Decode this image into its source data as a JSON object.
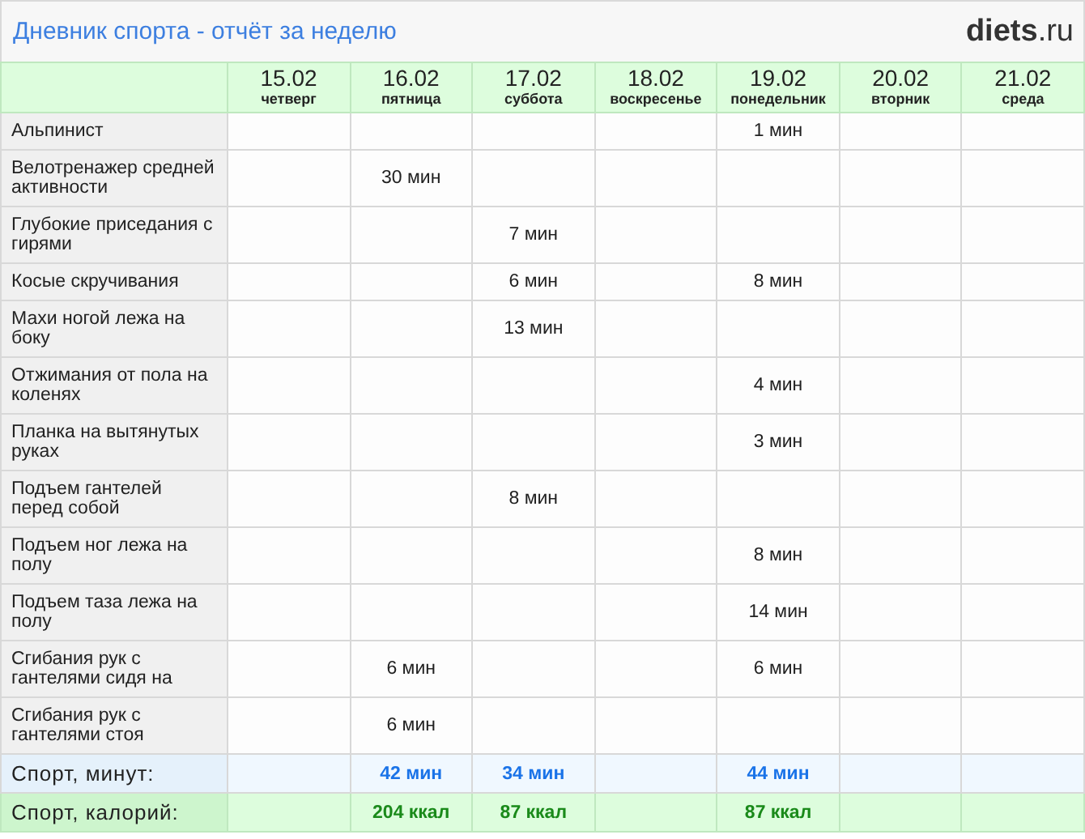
{
  "title": "Дневник спорта - отчёт за неделю",
  "logo": {
    "main": "diets",
    "suffix": ".ru"
  },
  "days": [
    {
      "date": "15.02",
      "weekday": "четверг"
    },
    {
      "date": "16.02",
      "weekday": "пятница"
    },
    {
      "date": "17.02",
      "weekday": "суббота"
    },
    {
      "date": "18.02",
      "weekday": "воскресенье"
    },
    {
      "date": "19.02",
      "weekday": "понедельник"
    },
    {
      "date": "20.02",
      "weekday": "вторник"
    },
    {
      "date": "21.02",
      "weekday": "среда"
    }
  ],
  "rows": [
    {
      "kind": "exercise",
      "name": "Альпинист",
      "cells": [
        {},
        {},
        {},
        {},
        {
          "text": "1 мин"
        },
        {},
        {}
      ]
    },
    {
      "kind": "exercise",
      "name": "Велотренажер средней активности",
      "cells": [
        {},
        {
          "text": "30 мин"
        },
        {},
        {},
        {},
        {},
        {}
      ]
    },
    {
      "kind": "exercise",
      "name": "Глубокие приседания с гирями",
      "cells": [
        {},
        {},
        {
          "text": "7 мин"
        },
        {},
        {},
        {},
        {}
      ]
    },
    {
      "kind": "exercise",
      "name": "Косые скручивания",
      "cells": [
        {},
        {},
        {
          "text": "6 мин"
        },
        {},
        {
          "text": "8 мин"
        },
        {},
        {}
      ]
    },
    {
      "kind": "exercise",
      "name": "Махи ногой лежа на боку",
      "cells": [
        {},
        {},
        {
          "text": "13 мин"
        },
        {},
        {},
        {},
        {}
      ]
    },
    {
      "kind": "exercise",
      "name": "Отжимания от пола на коленях",
      "cells": [
        {},
        {},
        {},
        {},
        {
          "text": "4 мин"
        },
        {},
        {}
      ]
    },
    {
      "kind": "exercise",
      "name": "Планка на вытянутых руках",
      "cells": [
        {},
        {},
        {},
        {},
        {
          "text": "3 мин"
        },
        {},
        {}
      ]
    },
    {
      "kind": "exercise",
      "name": "Подъем гантелей перед собой",
      "cells": [
        {},
        {},
        {
          "text": "8 мин"
        },
        {},
        {},
        {},
        {}
      ]
    },
    {
      "kind": "exercise",
      "name": "Подъем ног лежа на полу",
      "cells": [
        {},
        {},
        {},
        {},
        {
          "text": "8 мин"
        },
        {},
        {}
      ]
    },
    {
      "kind": "exercise",
      "name": "Подъем таза лежа на полу",
      "cells": [
        {},
        {},
        {},
        {},
        {
          "text": "14 мин"
        },
        {},
        {}
      ]
    },
    {
      "kind": "exercise",
      "name": "Сгибания рук с гантелями сидя на",
      "cells": [
        {},
        {
          "text": "6 мин"
        },
        {},
        {},
        {
          "text": "6 мин"
        },
        {},
        {}
      ]
    },
    {
      "kind": "exercise",
      "name": "Сгибания рук с гантелями стоя",
      "cells": [
        {},
        {
          "text": "6 мин"
        },
        {},
        {},
        {},
        {},
        {}
      ]
    },
    {
      "kind": "minutes",
      "name": "Спорт, минут:",
      "cells": [
        {},
        {
          "text": "42 мин"
        },
        {
          "text": "34 мин"
        },
        {},
        {
          "text": "44 мин"
        },
        {},
        {}
      ]
    },
    {
      "kind": "calories",
      "name": "Спорт, калорий:",
      "cells": [
        {},
        {
          "text": "204 ккал"
        },
        {
          "text": "87 ккал"
        },
        {},
        {
          "text": "87 ккал"
        },
        {},
        {}
      ]
    }
  ]
}
